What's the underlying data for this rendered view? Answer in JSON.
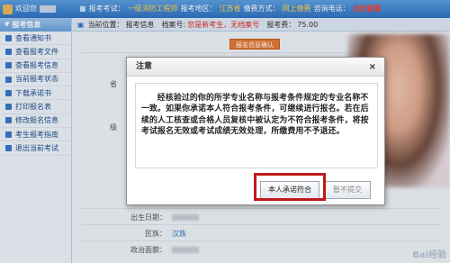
{
  "topbar": {
    "welcome": "欢迎您",
    "exam_label": "报考考试：",
    "exam_value": "一级消防工程师",
    "region_label": "报考地区：",
    "region_value": "江苏省",
    "pay_label": "缴费方式：",
    "pay_value": "网上缴费",
    "phone_label": "咨询电话：",
    "phone_link": "点击查看"
  },
  "sidebar": {
    "header": "报考信息",
    "items": [
      {
        "label": "查看通知书"
      },
      {
        "label": "查看报考文件"
      },
      {
        "label": "查看报考信息"
      },
      {
        "label": "当前报考状态"
      },
      {
        "label": "下载承诺书"
      },
      {
        "label": "打印报名表"
      },
      {
        "label": "修改报名信息"
      },
      {
        "label": "考生报考指南"
      },
      {
        "label": "退出当前考试"
      }
    ]
  },
  "mainhead": {
    "location_label": "当前位置：",
    "location_value": "报考信息",
    "file_label": "档案号:",
    "file_value": "您是新考生，无档案号",
    "fee_label": "报考费：",
    "fee_value": "75.00"
  },
  "content": {
    "confirm_tab": "报名信息确认",
    "label_a": "省",
    "label_b": "级",
    "rows": {
      "birth_label": "出生日期：",
      "nation_label": "民族：",
      "nation_value": "汉族",
      "political_label": "政治面貌："
    }
  },
  "dialog": {
    "title": "注意",
    "close": "×",
    "message": "经核验过的你的所学专业名称与报考条件规定的专业名称不一致。如果你承诺本人符合报考条件，可继续进行报名。若在后续的人工核查或合格人员复核中被认定为不符合报考条件，将按考试报名无效或考试成绩无效处理，所缴费用不予退还。",
    "accept_label": "本人承诺符合",
    "decline_label": "暂不提交"
  },
  "watermark": "Bai经验"
}
